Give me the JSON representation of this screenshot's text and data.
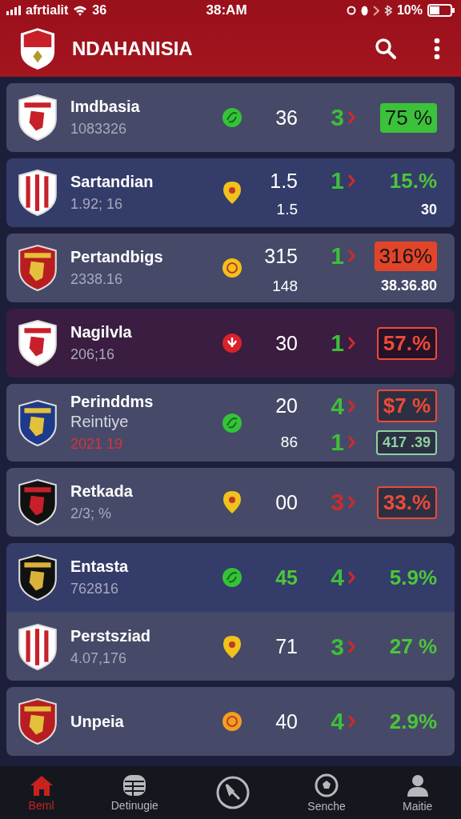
{
  "status_bar": {
    "carrier": "afrtialit",
    "signal_text": "36",
    "time": "38:AM",
    "battery": "10%"
  },
  "header": {
    "title": "NDAHANISIA"
  },
  "matches": [
    {
      "name": "Imdbasia",
      "code": "1083326",
      "code_alert": false,
      "kind": "ball",
      "color": "#35c23a",
      "stats": [
        {
          "score": "36",
          "score_green": false,
          "rank": "3",
          "rising": true,
          "pct": "75 %",
          "kind": "solid-badge",
          "color": "#3cc23a"
        }
      ]
    },
    {
      "name": "Sartandian",
      "code": "1.92; 16",
      "code_alert": false,
      "kind": "pin",
      "color": "#f1c21b",
      "stats": [
        {
          "score": "1.5",
          "score_green": false,
          "rank": "1",
          "rising": true,
          "pct": "15.%",
          "kind": "plain",
          "color": "#4bc63a"
        },
        {
          "score": "1.5",
          "score_green": false,
          "pct": "30",
          "kind": "plain",
          "color": "#ffffff"
        }
      ]
    },
    {
      "name": "Pertandbigs",
      "code": "2338.16",
      "code_alert": false,
      "kind": "coin",
      "color": "#f1c21b",
      "stats": [
        {
          "score": "315",
          "score_green": false,
          "rank": "1",
          "rising": true,
          "pct": "316%",
          "kind": "solid-badge",
          "color": "#e2442a"
        },
        {
          "score": "148",
          "score_green": false,
          "pct": "38.36.80",
          "kind": "plain",
          "color": "#ffffff"
        }
      ]
    },
    {
      "name": "Nagilvla",
      "code": "206;16",
      "code_alert": false,
      "kind": "flower",
      "color": "#d8232a",
      "stats": [
        {
          "score": "30",
          "score_green": false,
          "rank": "1",
          "rising": true,
          "pct": "57.%",
          "kind": "dark-badge",
          "color": "#f04a36"
        }
      ]
    },
    {
      "name": "Perinddms",
      "sub": "Reintiye",
      "code": "2021 19",
      "code_alert": true,
      "kind": "ball",
      "color": "#35c23a",
      "stats": [
        {
          "score": "20",
          "score_green": false,
          "rank": "4",
          "rising": true,
          "pct": "$7 %",
          "kind": "dark-badge",
          "color": "#f04a36"
        },
        {
          "score": "86",
          "score_green": false,
          "rank": "1",
          "rising": true,
          "pct": "417 .39",
          "kind": "dark-badge",
          "color": "#8ed2a0"
        }
      ]
    },
    {
      "name": "Retkada",
      "code": "2/3; %",
      "code_alert": false,
      "kind": "pin",
      "color": "#f1c21b",
      "stats": [
        {
          "score": "00",
          "score_green": false,
          "rank": "3",
          "rising": false,
          "pct": "33.%",
          "kind": "dark-badge",
          "color": "#f04a36"
        }
      ]
    },
    {
      "name": "Entasta",
      "code": "762816",
      "code_alert": false,
      "kind": "ball",
      "color": "#35c23a",
      "stats": [
        {
          "score": "45",
          "score_green": true,
          "rank": "4",
          "rising": true,
          "pct": "5.9%",
          "kind": "plain",
          "color": "#4bc63a"
        }
      ]
    },
    {
      "name": "Perstsziad",
      "code": "4.07,176",
      "code_alert": false,
      "kind": "pin",
      "color": "#f1c21b",
      "stats": [
        {
          "score": "71",
          "score_green": false,
          "rank": "3",
          "rising": true,
          "pct": "27 %",
          "kind": "plain",
          "color": "#4bc63a"
        }
      ]
    },
    {
      "name": "Unpeia",
      "kind": "coin",
      "color": "#f0a020",
      "stats": [
        {
          "score": "40",
          "score_green": false,
          "rank": "4",
          "rising": true,
          "pct": "2.9%",
          "kind": "plain",
          "color": "#4bc63a"
        }
      ]
    }
  ],
  "nav": [
    {
      "kind": "home",
      "label": "Beml",
      "selected": true
    },
    {
      "kind": "table",
      "label": "Detinugie",
      "selected": false
    },
    {
      "kind": "compass",
      "selected": false
    },
    {
      "kind": "ball",
      "label": "Senche",
      "selected": false
    },
    {
      "kind": "person",
      "label": "Maitie",
      "selected": false
    }
  ]
}
